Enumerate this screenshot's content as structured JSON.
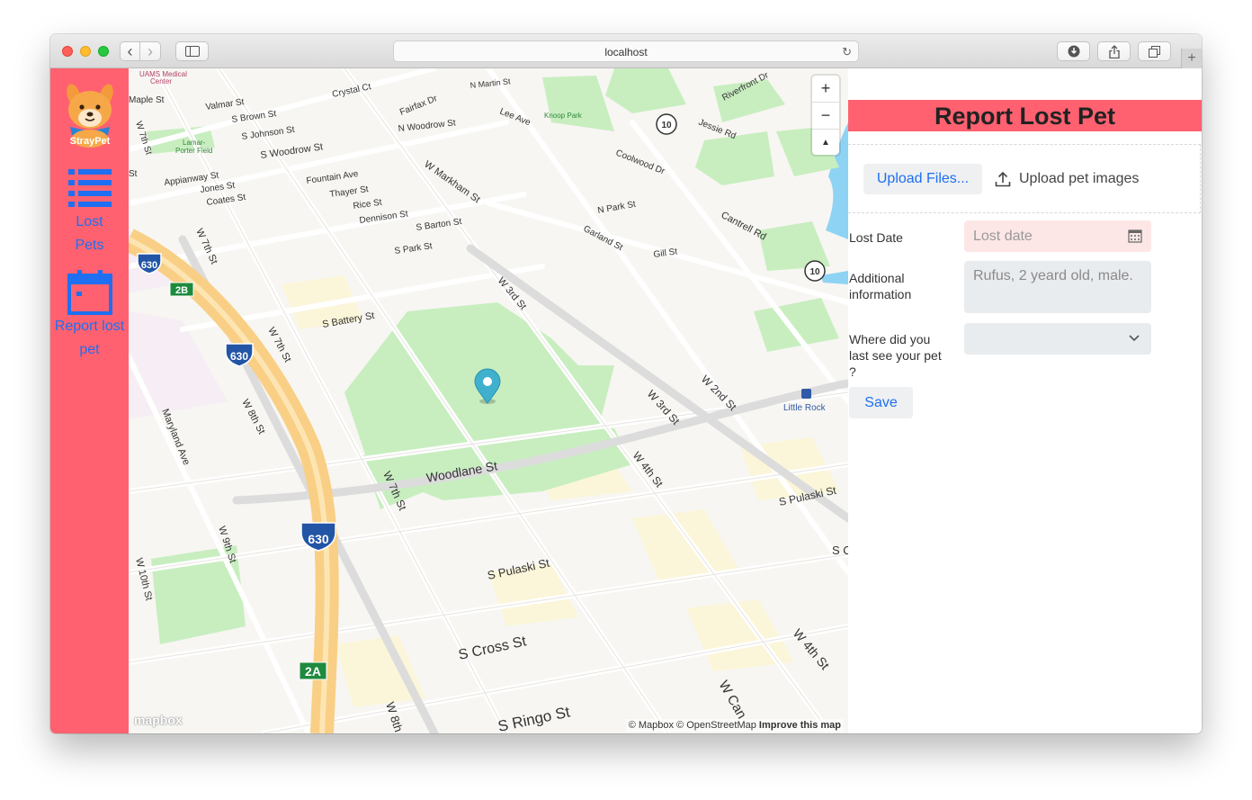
{
  "browser": {
    "url": "localhost",
    "back_label": "‹",
    "forward_label": "›",
    "new_tab_label": "+"
  },
  "sidebar": {
    "logo_text": "StrayPet",
    "items": [
      {
        "line1": "Lost",
        "line2": "Pets",
        "icon": "list-icon"
      },
      {
        "line1": "Report lost",
        "line2": "pet",
        "icon": "calendar-icon"
      }
    ],
    "colors": {
      "background": "#ff6170",
      "link": "#1e6ff1"
    }
  },
  "map": {
    "zoom_in": "+",
    "zoom_out": "−",
    "compass": "▲",
    "logo": "mapbox",
    "attribution": "© Mapbox © OpenStreetMap",
    "improve": "Improve this map",
    "labels": {
      "uams": "UAMS Medical",
      "uams2": "Center",
      "maple": "Maple St",
      "valmar": "Valmar St",
      "crystal": "Crystal Ct",
      "nmartin": "N Martin St",
      "riverfront": "Riverfront Dr",
      "fairfax": "Fairfax Dr",
      "sbrown": "S Brown St",
      "nwoodrow": "N Woodrow St",
      "leeave": "Lee Ave",
      "knoop": "Knoop Park",
      "jessie": "Jessie Rd",
      "w7th_top": "W 7th St",
      "sjohnson": "S Johnson St",
      "lamar": "Lamar-",
      "lamar2": "Porter Field",
      "swoodrow": "S Woodrow St",
      "coolwood": "Coolwood Dr",
      "wmarkham": "W Markham St",
      "appianway": "Appianway St",
      "fountain": "Fountain Ave",
      "jones": "Jones St",
      "thayer": "Thayer St",
      "coates": "Coates St",
      "rice": "Rice St",
      "npark": "N Park St",
      "cantrell": "Cantrell Rd",
      "dennison": "Dennison St",
      "sbarton": "S Barton St",
      "garland": "Garland St",
      "gill": "Gill St",
      "spark": "S Park St",
      "w7th_mid": "W 7th St",
      "w3rd_a": "W 3rd St",
      "sbattery": "S Battery St",
      "w7th_b": "W 7th St",
      "w8th": "W 8th St",
      "w3rd_b": "W 3rd St",
      "w2nd": "W 2nd St",
      "littlerock": "Little Rock",
      "maryland": "Maryland Ave",
      "woodlane": "Woodlane St",
      "w4th_a": "W 4th St",
      "w7th_c": "W 7th St",
      "spulaski_r": "S Pulaski St",
      "w9th": "W 9th St",
      "w10th": "W 10th St",
      "spulaski": "S Pulaski St",
      "scross": "S Cross St",
      "w4th_b": "W 4th St",
      "sringo": "S Ringo St",
      "wcan": "W Can",
      "w8th_b": "W 8th",
      "sc": "S C",
      "s_left": "St"
    },
    "shields": {
      "i630_a": "630",
      "i630_b": "630",
      "i630_c": "630",
      "exit_2b": "2B",
      "exit_2a": "2A",
      "hwy10_a": "10",
      "hwy10_b": "10"
    }
  },
  "form": {
    "title": "Report Lost Pet",
    "upload_button": "Upload Files...",
    "upload_hint": "Upload pet images",
    "lost_date_label": "Lost Date",
    "lost_date_placeholder": "Lost date",
    "info_label_1": "Additional",
    "info_label_2": "information",
    "info_placeholder": "Rufus, 2 yeard old, male.",
    "where_label_1": "Where did you",
    "where_label_2": "last see your pet",
    "where_label_3": "?",
    "where_value": "",
    "save_label": "Save",
    "colors": {
      "title_bar": "#ff6170",
      "date_field": "#fde6e6",
      "field": "#e9ecef",
      "button_text": "#1e6ff1"
    }
  }
}
